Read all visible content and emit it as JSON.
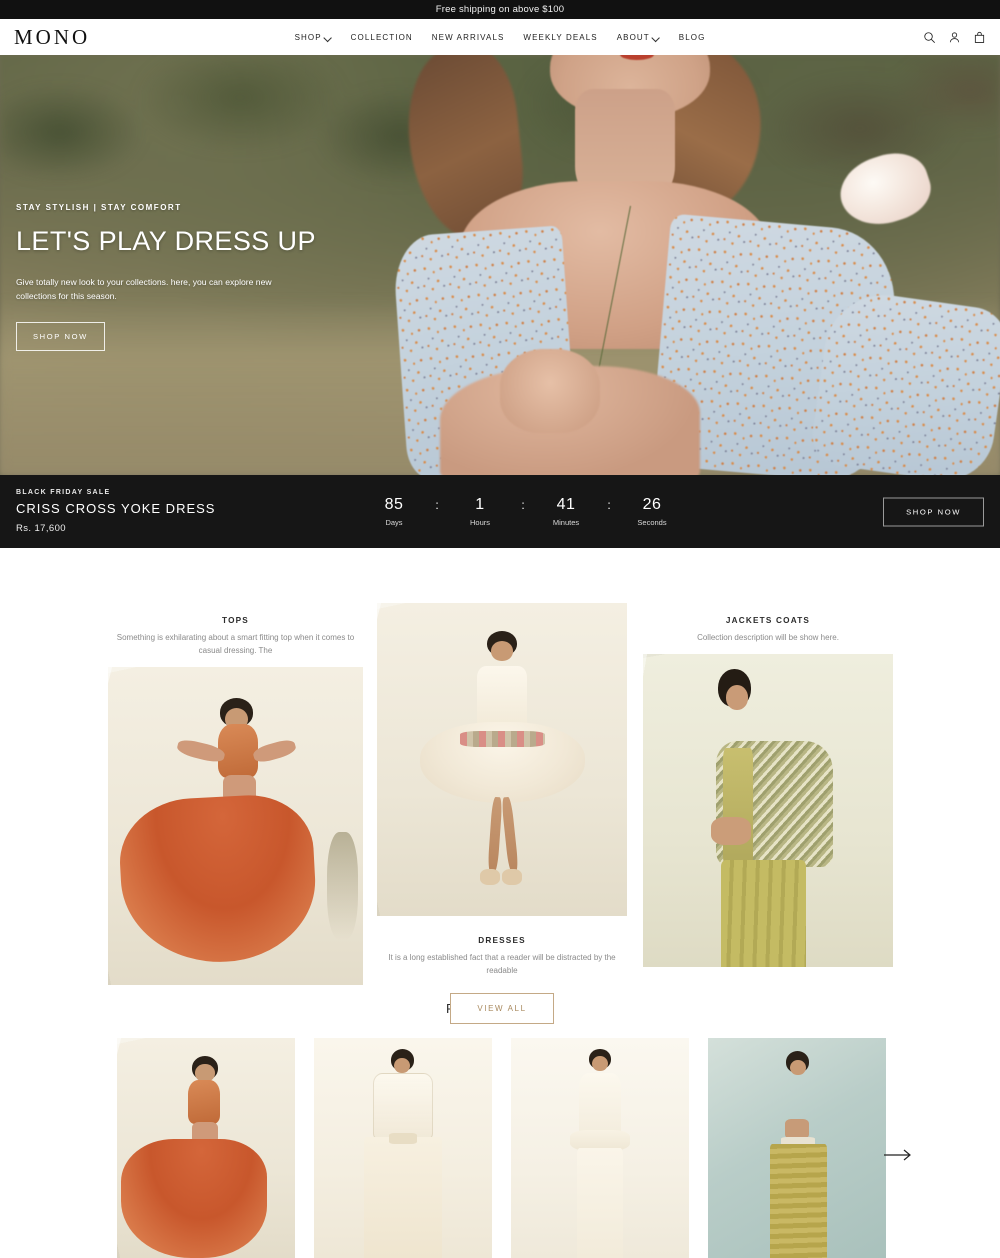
{
  "announcement": {
    "text": "Free shipping on above $100"
  },
  "header": {
    "logo": "MONO",
    "nav": [
      {
        "label": "SHOP",
        "has_dropdown": true
      },
      {
        "label": "COLLECTION",
        "has_dropdown": false
      },
      {
        "label": "NEW ARRIVALS",
        "has_dropdown": false
      },
      {
        "label": "WEEKLY DEALS",
        "has_dropdown": false
      },
      {
        "label": "ABOUT",
        "has_dropdown": true
      },
      {
        "label": "BLOG",
        "has_dropdown": false
      }
    ],
    "icons": [
      "search-icon",
      "account-icon",
      "cart-icon"
    ]
  },
  "hero": {
    "eyebrow": "STAY STYLISH | STAY COMFORT",
    "title": "LET'S PLAY DRESS UP",
    "subtitle": "Give totally new look to your collections. here, you can explore new collections for this season.",
    "cta": "SHOP NOW"
  },
  "deal": {
    "kicker": "BLACK FRIDAY SALE",
    "product": "CRISS CROSS YOKE DRESS",
    "price": "Rs. 17,600",
    "cta": "SHOP NOW",
    "countdown": [
      {
        "value": "85",
        "label": "Days"
      },
      {
        "value": "1",
        "label": "Hours"
      },
      {
        "value": "41",
        "label": "Minutes"
      },
      {
        "value": "26",
        "label": "Seconds"
      }
    ],
    "separator": ":",
    "background_color": "#161616"
  },
  "collections": {
    "cards": [
      {
        "title": "TOPS",
        "description": "Something is exhilarating about a smart fitting top when it comes to casual dressing. The"
      },
      {
        "title": "DRESSES",
        "description": "It is a long established fact that a reader will be distracted by the readable"
      },
      {
        "title": "JACKETS COATS",
        "description": "Collection description will be show here."
      }
    ],
    "view_all": "VIEW ALL",
    "view_all_color": "#a98a5f"
  },
  "people_pick": {
    "heading": "PEOPLE PICK",
    "next_icon": "arrow-right-icon",
    "items": [
      {
        "name": "orange-halter-skirt-set"
      },
      {
        "name": "ivory-sheer-shirt-skirt"
      },
      {
        "name": "cream-halter-layered-gown"
      },
      {
        "name": "olive-metallic-crop-skirt"
      }
    ]
  }
}
